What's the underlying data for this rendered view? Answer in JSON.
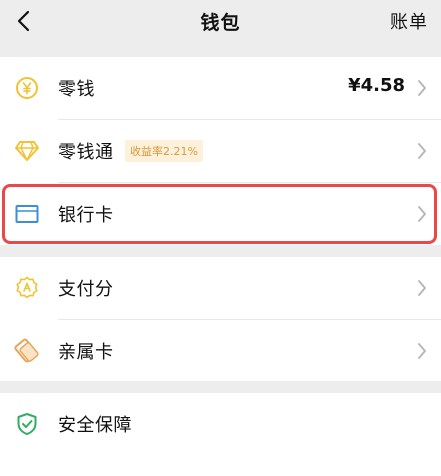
{
  "nav": {
    "title": "钱包",
    "right_action": "账单",
    "back_icon": "chevron-left-icon"
  },
  "group1": {
    "items": [
      {
        "label": "零钱",
        "value": "¥4.58",
        "icon": "yen-coin-icon",
        "icon_color": "#f1c232"
      },
      {
        "label": "零钱通",
        "badge": "收益率2.21%",
        "icon": "diamond-icon",
        "icon_color": "#f1c232"
      },
      {
        "label": "银行卡",
        "icon": "bank-card-icon",
        "icon_color": "#3b8fd6",
        "highlighted": true
      }
    ]
  },
  "group2": {
    "items": [
      {
        "label": "支付分",
        "icon": "score-badge-icon",
        "icon_color": "#f1c232"
      },
      {
        "label": "亲属卡",
        "icon": "family-card-icon",
        "icon_color": "#e8a55a"
      }
    ]
  },
  "group3": {
    "items": [
      {
        "label": "安全保障",
        "icon": "shield-check-icon",
        "icon_color": "#2fae63"
      }
    ]
  },
  "colors": {
    "background": "#ededed",
    "card": "#ffffff",
    "highlight_border": "#e84a4a",
    "badge_bg": "#fdf1dc",
    "badge_text": "#d69a3a"
  }
}
